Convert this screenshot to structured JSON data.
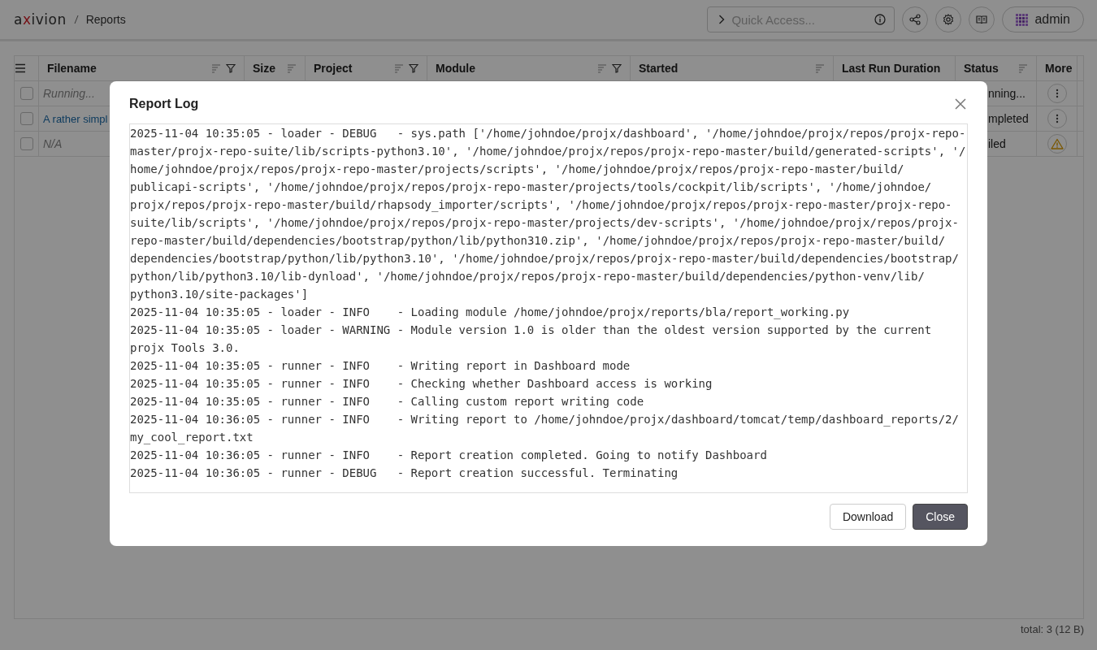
{
  "header": {
    "logo": "axivion",
    "breadcrumb": [
      {
        "label": "Reports"
      }
    ],
    "quick_access": {
      "placeholder": "Quick Access..."
    },
    "user": "admin"
  },
  "table": {
    "columns": [
      {
        "label": "Filename",
        "sortable": true,
        "filterable": true
      },
      {
        "label": "Size",
        "sortable": true,
        "filterable": false
      },
      {
        "label": "Project",
        "sortable": true,
        "filterable": true
      },
      {
        "label": "Module",
        "sortable": true,
        "filterable": true
      },
      {
        "label": "Started",
        "sortable": true,
        "filterable": false
      },
      {
        "label": "Last Run Duration",
        "sortable": false,
        "filterable": false
      },
      {
        "label": "Status",
        "sortable": true,
        "filterable": false
      },
      {
        "label": "More",
        "sortable": false,
        "filterable": false
      }
    ],
    "rows": [
      {
        "checked": false,
        "filename": {
          "text": "Running...",
          "kind": "placeholder"
        },
        "status": "nning...",
        "more": {
          "kind": "menu"
        }
      },
      {
        "checked": false,
        "filename": {
          "text": "A rather simpl",
          "kind": "link"
        },
        "status": "mpleted",
        "more": {
          "kind": "menu"
        }
      },
      {
        "checked": false,
        "filename": {
          "text": "N/A",
          "kind": "placeholder"
        },
        "status": "iled",
        "more": {
          "kind": "warning"
        }
      }
    ]
  },
  "footer": {
    "total": "total: 3 (12 B)"
  },
  "dialog": {
    "title": "Report Log",
    "log": [
      "2025-11-04 10:35:05 - loader - DEBUG   - sys.path ['/home/johndoe/projx/dashboard', '/home/johndoe/projx/repos/projx-repo-master/projx-repo-suite/lib/scripts-python3.10', '/home/johndoe/projx/repos/projx-repo-master/build/generated-scripts', '/home/johndoe/projx/repos/projx-repo-master/projects/scripts', '/home/johndoe/projx/repos/projx-repo-master/build/publicapi-scripts', '/home/johndoe/projx/repos/projx-repo-master/projects/tools/cockpit/lib/scripts', '/home/johndoe/projx/repos/projx-repo-master/build/rhapsody_importer/scripts', '/home/johndoe/projx/repos/projx-repo-master/projx-repo-suite/lib/scripts', '/home/johndoe/projx/repos/projx-repo-master/projects/dev-scripts', '/home/johndoe/projx/repos/projx-repo-master/build/dependencies/bootstrap/python/lib/python310.zip', '/home/johndoe/projx/repos/projx-repo-master/build/dependencies/bootstrap/python/lib/python3.10', '/home/johndoe/projx/repos/projx-repo-master/build/dependencies/bootstrap/python/lib/python3.10/lib-dynload', '/home/johndoe/projx/repos/projx-repo-master/build/dependencies/python-venv/lib/python3.10/site-packages']",
      "2025-11-04 10:35:05 - loader - INFO    - Loading module /home/johndoe/projx/reports/bla/report_working.py",
      "2025-11-04 10:35:05 - loader - WARNING - Module version 1.0 is older than the oldest version supported by the current projx Tools 3.0.",
      "2025-11-04 10:35:05 - runner - INFO    - Writing report in Dashboard mode",
      "2025-11-04 10:35:05 - runner - INFO    - Checking whether Dashboard access is working",
      "2025-11-04 10:35:05 - runner - INFO    - Calling custom report writing code",
      "2025-11-04 10:36:05 - runner - INFO    - Writing report to /home/johndoe/projx/dashboard/tomcat/temp/dashboard_reports/2/my_cool_report.txt",
      "2025-11-04 10:36:05 - runner - INFO    - Report creation completed. Going to notify Dashboard",
      "2025-11-04 10:36:05 - runner - DEBUG   - Report creation successful. Terminating"
    ],
    "buttons": [
      {
        "label": "Download",
        "kind": "secondary"
      },
      {
        "label": "Close",
        "kind": "primary"
      }
    ]
  }
}
